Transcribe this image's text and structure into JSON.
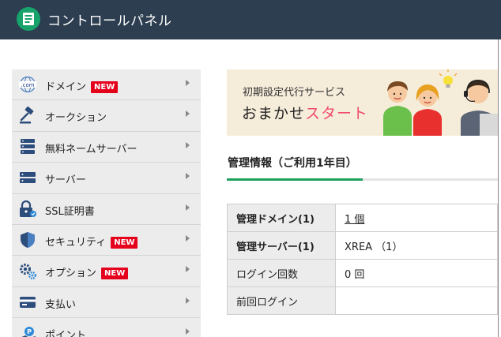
{
  "header": {
    "title": "コントロールパネル",
    "logo_icon": "control-panel-logo-icon"
  },
  "sidebar": {
    "items": [
      {
        "label": "ドメイン",
        "badge": "NEW",
        "icon": "dotcom-globe-icon"
      },
      {
        "label": "オークション",
        "icon": "gavel-icon"
      },
      {
        "label": "無料ネームサーバー",
        "icon": "server-stack-icon"
      },
      {
        "label": "サーバー",
        "icon": "server-icon"
      },
      {
        "label": "SSL証明書",
        "icon": "ssl-lock-icon"
      },
      {
        "label": "セキュリティ",
        "badge": "NEW",
        "icon": "shield-icon"
      },
      {
        "label": "オプション",
        "badge": "NEW",
        "icon": "gears-icon"
      },
      {
        "label": "支払い",
        "icon": "credit-card-icon"
      },
      {
        "label": "ポイント",
        "icon": "point-icon"
      }
    ]
  },
  "banner": {
    "subtitle": "初期設定代行サービス",
    "title_main": "おまかせ",
    "title_accent": "スタート"
  },
  "management": {
    "title": "管理情報（ご利用1年目）",
    "progress_fraction": 0.5,
    "rows": [
      {
        "label": "管理ドメイン(1)",
        "value": "1 個",
        "link": true
      },
      {
        "label": "管理サーバー(1)",
        "value": "XREA （1）"
      },
      {
        "label": "ログイン回数",
        "value": "0 回"
      },
      {
        "label": "前回ログイン",
        "value": ""
      }
    ]
  },
  "colors": {
    "header_bg": "#2c3e50",
    "logo_green": "#18a36b",
    "badge_red": "#e5001c",
    "banner_accent": "#ef4b6b",
    "progress_green": "#1ea15c"
  }
}
